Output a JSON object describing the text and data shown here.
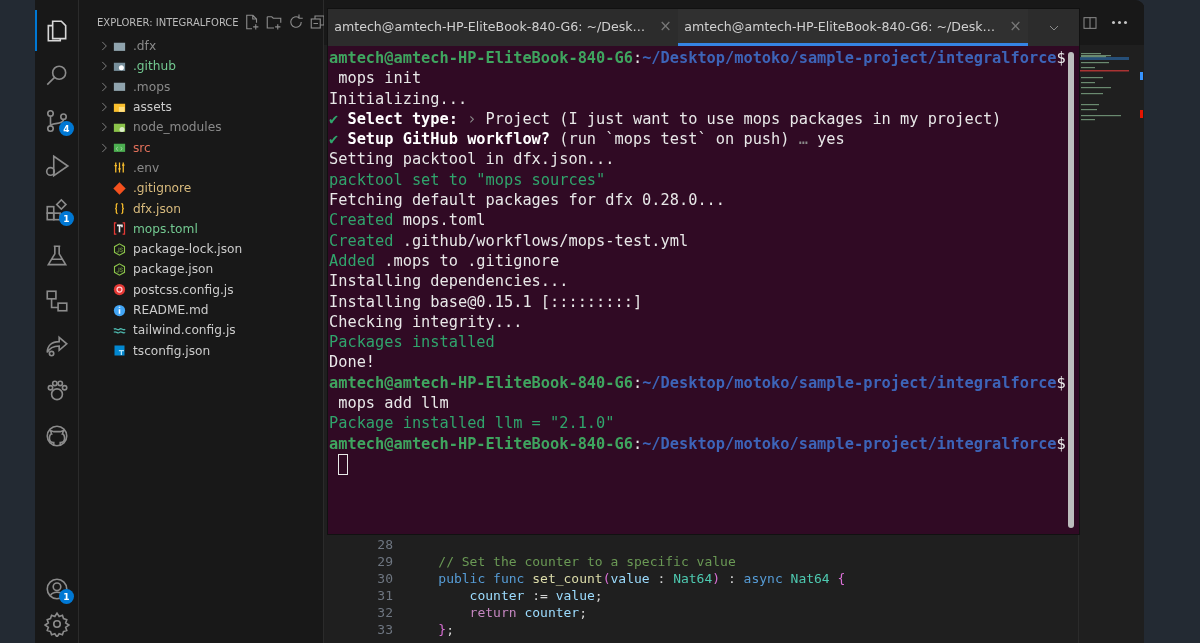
{
  "activity_bar": {
    "items": [
      {
        "selected": true
      },
      {
        "selected": false
      },
      {
        "selected": false,
        "badge": "4"
      },
      {
        "selected": false
      },
      {
        "selected": false,
        "badge": "1"
      },
      {
        "selected": false
      },
      {
        "selected": false
      },
      {
        "selected": false
      },
      {
        "selected": false
      },
      {
        "selected": false
      }
    ],
    "account_badge": "1"
  },
  "explorer": {
    "title": "EXPLORER: INTEGRALFORCE",
    "items": [
      {
        "name": ".dfx",
        "kind": "folder",
        "color": "#8a8a8a"
      },
      {
        "name": ".github",
        "kind": "folder",
        "color": "#73c991"
      },
      {
        "name": ".mops",
        "kind": "folder",
        "color": "#8a8a8a"
      },
      {
        "name": "assets",
        "kind": "folder",
        "color": "#cccccc"
      },
      {
        "name": "node_modules",
        "kind": "folder",
        "color": "#8a8a8a"
      },
      {
        "name": "src",
        "kind": "folder",
        "color": "#e2705a"
      },
      {
        "name": ".env",
        "kind": "file",
        "color": "#8a8a8a"
      },
      {
        "name": ".gitignore",
        "kind": "file",
        "color": "#d7ba7d"
      },
      {
        "name": "dfx.json",
        "kind": "file",
        "color": "#d7ba7d"
      },
      {
        "name": "mops.toml",
        "kind": "file",
        "color": "#73c991"
      },
      {
        "name": "package-lock.json",
        "kind": "file",
        "color": "#cccccc"
      },
      {
        "name": "package.json",
        "kind": "file",
        "color": "#cccccc"
      },
      {
        "name": "postcss.config.js",
        "kind": "file",
        "color": "#cccccc"
      },
      {
        "name": "README.md",
        "kind": "file",
        "color": "#cccccc"
      },
      {
        "name": "tailwind.config.js",
        "kind": "file",
        "color": "#cccccc"
      },
      {
        "name": "tsconfig.json",
        "kind": "file",
        "color": "#cccccc"
      }
    ]
  },
  "editor": {
    "lines": [
      {
        "number": "28"
      },
      {
        "number": "29",
        "segments": [
          {
            "kind": "comment",
            "text": "    // Set the counter to a specific value"
          }
        ]
      },
      {
        "number": "30",
        "segments": [
          {
            "kind": "keyword",
            "text": "    public func "
          },
          {
            "kind": "function",
            "text": "set_count"
          },
          {
            "kind": "bracket",
            "text": "("
          },
          {
            "kind": "variable",
            "text": "value"
          },
          {
            "kind": "plain",
            "text": " : "
          },
          {
            "kind": "type",
            "text": "Nat64"
          },
          {
            "kind": "bracket",
            "text": ")"
          },
          {
            "kind": "plain",
            "text": " : "
          },
          {
            "kind": "keyword",
            "text": "async "
          },
          {
            "kind": "type",
            "text": "Nat64 "
          },
          {
            "kind": "bracket",
            "text": "{"
          }
        ]
      },
      {
        "number": "31",
        "segments": [
          {
            "kind": "variable",
            "text": "        counter"
          },
          {
            "kind": "plain",
            "text": " := "
          },
          {
            "kind": "variable",
            "text": "value"
          },
          {
            "kind": "plain",
            "text": ";"
          }
        ]
      },
      {
        "number": "32",
        "segments": [
          {
            "kind": "control",
            "text": "        return "
          },
          {
            "kind": "variable",
            "text": "counter"
          },
          {
            "kind": "plain",
            "text": ";"
          }
        ]
      },
      {
        "number": "33",
        "segments": [
          {
            "kind": "bracket",
            "text": "    }"
          },
          {
            "kind": "plain",
            "text": ";"
          }
        ]
      }
    ]
  },
  "terminal": {
    "tabs": [
      {
        "title": "amtech@amtech-HP-EliteBook-840-G6: ~/Desk…",
        "close": "×",
        "selected": false
      },
      {
        "title": "amtech@amtech-HP-EliteBook-840-G6: ~/Desk…",
        "close": "×",
        "selected": true
      }
    ],
    "lines": [
      [
        {
          "kind": "user",
          "text": "amtech@amtech-HP-EliteBook-840-G6"
        },
        {
          "kind": "plain",
          "text": ":"
        },
        {
          "kind": "path",
          "text": "~/Desktop/motoko/sample-project/integralforce"
        },
        {
          "kind": "plain",
          "text": "$"
        }
      ],
      [
        {
          "kind": "plain",
          "text": " mops init"
        }
      ],
      [
        {
          "kind": "plain",
          "text": "Initializing..."
        }
      ],
      [
        {
          "kind": "green",
          "text": "✔ "
        },
        {
          "kind": "bold",
          "text": "Select type:"
        },
        {
          "kind": "dim",
          "text": " › "
        },
        {
          "kind": "plain",
          "text": "Project (I just want to use mops packages in my project)"
        }
      ],
      [
        {
          "kind": "green",
          "text": "✔ "
        },
        {
          "kind": "bold",
          "text": "Setup GitHub workflow?"
        },
        {
          "kind": "plain",
          "text": " (run `mops test` on push)"
        },
        {
          "kind": "dim",
          "text": " … "
        },
        {
          "kind": "plain",
          "text": "yes"
        }
      ],
      [
        {
          "kind": "plain",
          "text": "Setting packtool in dfx.json..."
        }
      ],
      [
        {
          "kind": "green",
          "text": "packtool set to \"mops sources\""
        }
      ],
      [
        {
          "kind": "plain",
          "text": "Fetching default packages for dfx 0.28.0..."
        }
      ],
      [
        {
          "kind": "green",
          "text": "Created"
        },
        {
          "kind": "plain",
          "text": " mops.toml"
        }
      ],
      [
        {
          "kind": "green",
          "text": "Created"
        },
        {
          "kind": "plain",
          "text": " .github/workflows/mops-test.yml"
        }
      ],
      [
        {
          "kind": "green",
          "text": "Added"
        },
        {
          "kind": "plain",
          "text": " .mops to .gitignore"
        }
      ],
      [
        {
          "kind": "plain",
          "text": "Installing dependencies..."
        }
      ],
      [
        {
          "kind": "plain",
          "text": "Installing base@0.15.1 [:::::::::]"
        }
      ],
      [
        {
          "kind": "plain",
          "text": "Checking integrity..."
        }
      ],
      [
        {
          "kind": "green",
          "text": "Packages installed"
        }
      ],
      [
        {
          "kind": "plain",
          "text": "Done!"
        }
      ],
      [
        {
          "kind": "user",
          "text": "amtech@amtech-HP-EliteBook-840-G6"
        },
        {
          "kind": "plain",
          "text": ":"
        },
        {
          "kind": "path",
          "text": "~/Desktop/motoko/sample-project/integralforce"
        },
        {
          "kind": "plain",
          "text": "$"
        }
      ],
      [
        {
          "kind": "plain",
          "text": " mops add llm"
        }
      ],
      [
        {
          "kind": "green",
          "text": "Package installed llm = \"2.1.0\""
        }
      ],
      [
        {
          "kind": "user",
          "text": "amtech@amtech-HP-EliteBook-840-G6"
        },
        {
          "kind": "plain",
          "text": ":"
        },
        {
          "kind": "path",
          "text": "~/Desktop/motoko/sample-project/integralforce"
        },
        {
          "kind": "plain",
          "text": "$"
        }
      ]
    ],
    "cursor": true
  }
}
